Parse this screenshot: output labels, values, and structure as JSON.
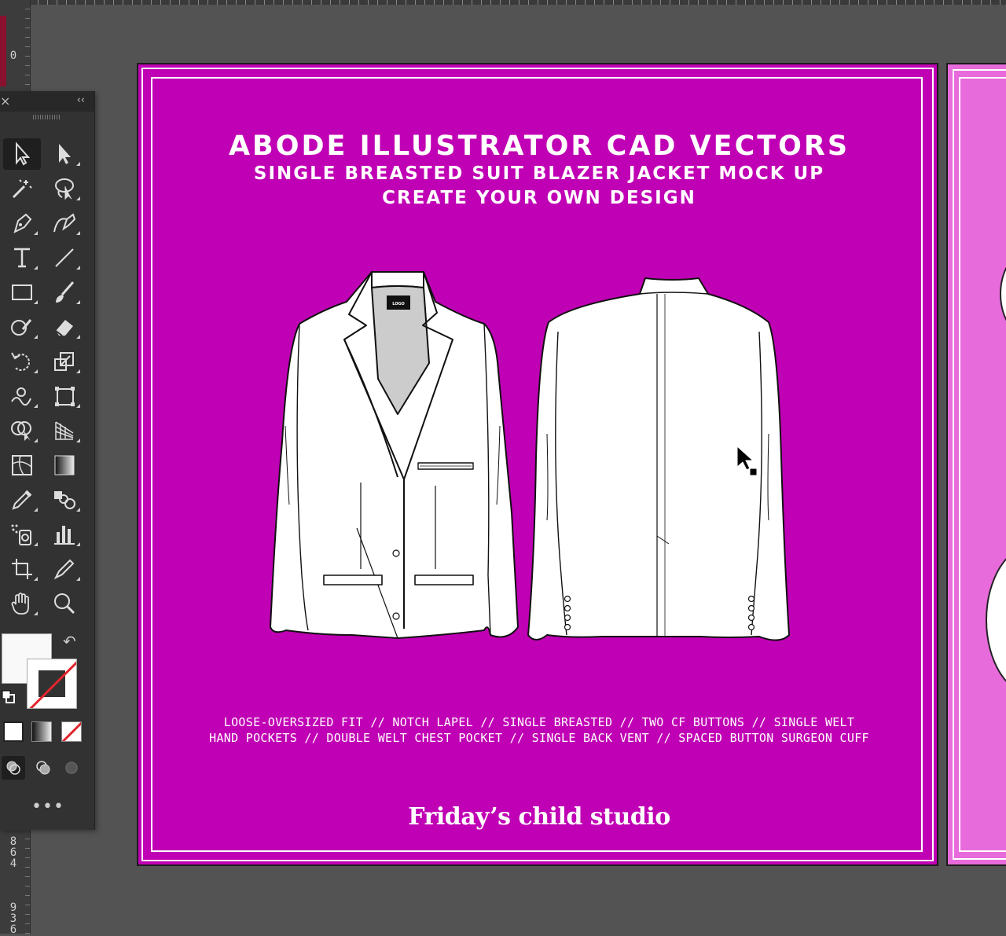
{
  "ruler": {
    "top_value": "0",
    "lower_values": [
      "864",
      "936"
    ]
  },
  "tools_panel": {
    "close_glyph": "×",
    "collapse_glyph": "‹‹",
    "more_glyph": "•••",
    "tools": [
      {
        "name": "selection-tool",
        "icon": "selection-arrow-icon"
      },
      {
        "name": "direct-selection-tool",
        "icon": "direct-selection-arrow-icon"
      },
      {
        "name": "magic-wand-tool",
        "icon": "magic-wand-icon"
      },
      {
        "name": "lasso-tool",
        "icon": "lasso-icon"
      },
      {
        "name": "pen-tool",
        "icon": "pen-icon"
      },
      {
        "name": "curvature-tool",
        "icon": "curvature-icon"
      },
      {
        "name": "type-tool",
        "icon": "type-icon",
        "glyph": "T"
      },
      {
        "name": "line-segment-tool",
        "icon": "line-icon"
      },
      {
        "name": "rectangle-tool",
        "icon": "rectangle-icon"
      },
      {
        "name": "paintbrush-tool",
        "icon": "paintbrush-icon"
      },
      {
        "name": "shaper-tool",
        "icon": "shaper-icon"
      },
      {
        "name": "eraser-tool",
        "icon": "eraser-icon"
      },
      {
        "name": "rotate-tool",
        "icon": "rotate-icon"
      },
      {
        "name": "scale-tool",
        "icon": "scale-icon"
      },
      {
        "name": "warp-tool",
        "icon": "warp-icon"
      },
      {
        "name": "free-transform-tool",
        "icon": "free-transform-icon"
      },
      {
        "name": "shape-builder-tool",
        "icon": "shape-builder-icon"
      },
      {
        "name": "perspective-grid-tool",
        "icon": "perspective-grid-icon"
      },
      {
        "name": "mesh-tool",
        "icon": "mesh-icon"
      },
      {
        "name": "gradient-tool",
        "icon": "gradient-icon"
      },
      {
        "name": "eyedropper-tool",
        "icon": "eyedropper-icon"
      },
      {
        "name": "blend-tool",
        "icon": "blend-icon"
      },
      {
        "name": "symbol-sprayer-tool",
        "icon": "symbol-sprayer-icon"
      },
      {
        "name": "column-graph-tool",
        "icon": "column-graph-icon"
      },
      {
        "name": "artboard-tool",
        "icon": "artboard-icon"
      },
      {
        "name": "slice-tool",
        "icon": "slice-icon"
      },
      {
        "name": "hand-tool",
        "icon": "hand-icon"
      },
      {
        "name": "zoom-tool",
        "icon": "zoom-icon"
      }
    ],
    "fill_color": "#f9f9f9",
    "stroke_color": "none"
  },
  "artboard": {
    "background": "#c000b4",
    "title": "ABODE ILLUSTRATOR CAD VECTORS",
    "subtitle_1": "SINGLE BREASTED SUIT BLAZER JACKET MOCK UP",
    "subtitle_2": "CREATE YOUR OWN DESIGN",
    "logo_label": "LOGO",
    "features_line_1": "LOOSE-OVERSIZED FIT // NOTCH LAPEL // SINGLE BREASTED // TWO CF BUTTONS // SINGLE WELT",
    "features_line_2": "HAND POCKETS // DOUBLE WELT CHEST POCKET // SINGLE BACK VENT // SPACED BUTTON SURGEON CUFF",
    "brand": "Friday’s child studio"
  },
  "artboard_2": {
    "background": "#e86bdc"
  }
}
